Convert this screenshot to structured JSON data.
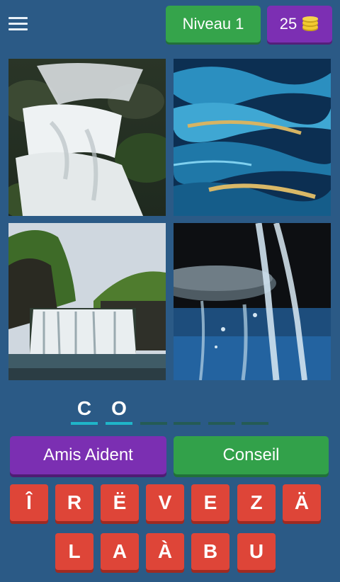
{
  "header": {
    "level_label": "Niveau 1",
    "coins": "25"
  },
  "images": [
    {
      "alt": "waterfall-cascade"
    },
    {
      "alt": "ocean-waves"
    },
    {
      "alt": "waterfall-cliff"
    },
    {
      "alt": "water-pour"
    }
  ],
  "answer_slots": [
    "C",
    "O",
    "",
    "",
    "",
    ""
  ],
  "actions": {
    "friends_label": "Amis Aident",
    "hint_label": "Conseil"
  },
  "keyboard": {
    "row1": [
      "Î",
      "R",
      "Ë",
      "V",
      "E",
      "Z",
      "Ä"
    ],
    "row2": [
      "L",
      "A",
      "À",
      "B",
      "U"
    ]
  },
  "colors": {
    "background": "#2b5a86",
    "filled_slot": "#1fb5c9",
    "empty_slot": "#245b55",
    "key": "#de4538"
  }
}
